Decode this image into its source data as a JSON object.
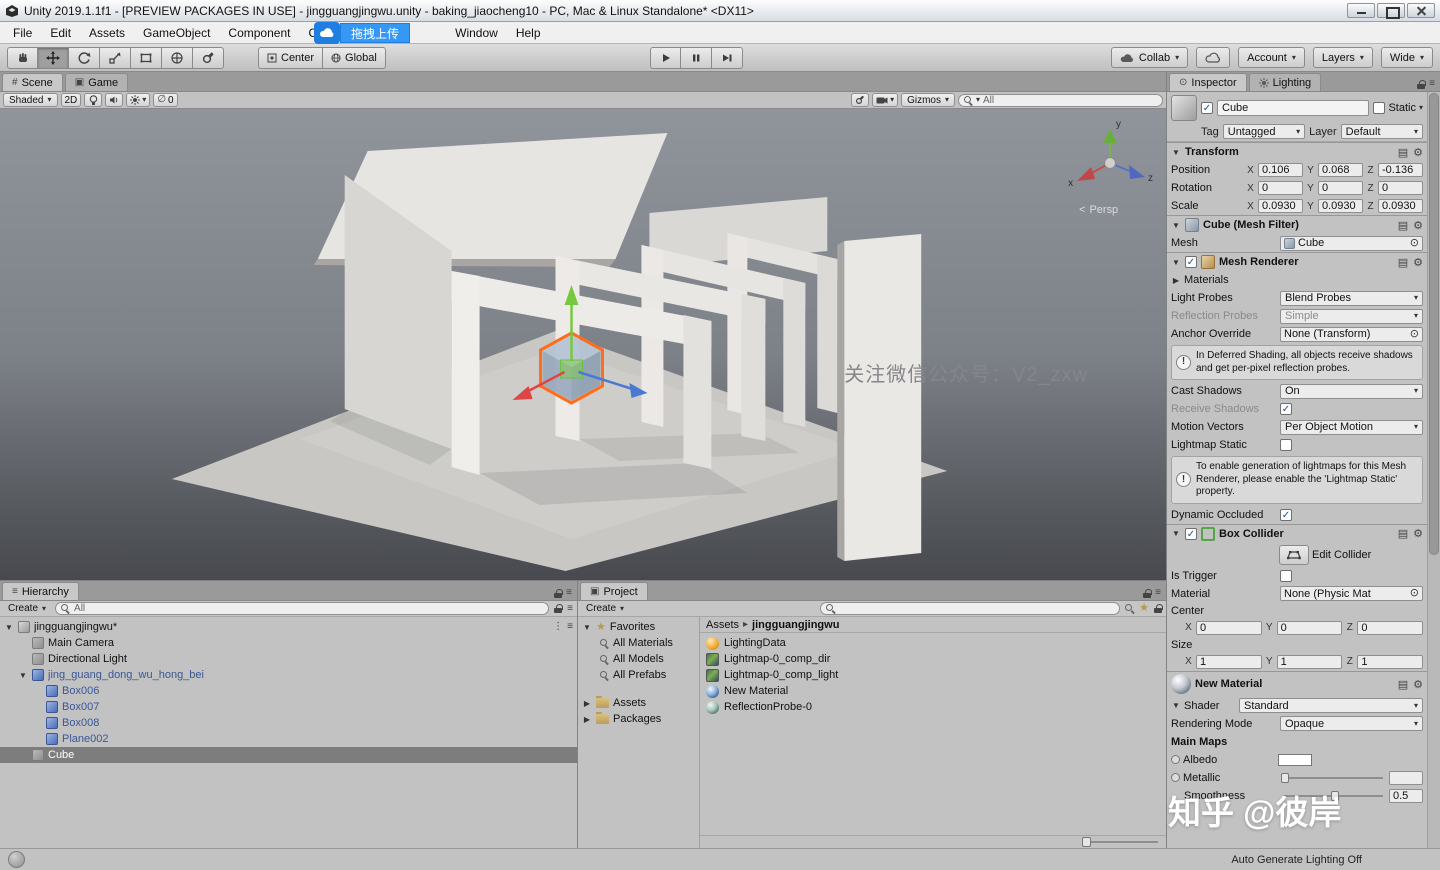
{
  "window": {
    "title": "Unity 2019.1.1f1 - [PREVIEW PACKAGES IN USE] - jingguangjingwu.unity - baking_jiaocheng10 - PC, Mac & Linux Standalone* <DX11>"
  },
  "menu": {
    "items": [
      "File",
      "Edit",
      "Assets",
      "GameObject",
      "Component",
      "Cine",
      "Window",
      "Help"
    ]
  },
  "upload_overlay": {
    "label": "拖拽上传"
  },
  "toolbar": {
    "pivot": "Center",
    "space": "Global",
    "collab": "Collab",
    "account": "Account",
    "layers": "Layers",
    "layout": "Wide"
  },
  "scene": {
    "tab_scene": "Scene",
    "tab_game": "Game",
    "shading": "Shaded",
    "mode_2d": "2D",
    "hidden_count": "0",
    "gizmos": "Gizmos",
    "search_value": "All",
    "persp": "Persp",
    "axis": {
      "x": "x",
      "y": "y",
      "z": "z"
    },
    "watermark": "关注微信公众号：V2_zxw"
  },
  "hierarchy": {
    "title": "Hierarchy",
    "create": "Create",
    "search_value": "All",
    "items": [
      {
        "label": "jingguangjingwu*"
      },
      {
        "label": "Main Camera"
      },
      {
        "label": "Directional Light"
      },
      {
        "label": "jing_guang_dong_wu_hong_bei"
      },
      {
        "label": "Box006"
      },
      {
        "label": "Box007"
      },
      {
        "label": "Box008"
      },
      {
        "label": "Plane002"
      },
      {
        "label": "Cube"
      }
    ]
  },
  "project": {
    "title": "Project",
    "create": "Create",
    "favorites_label": "Favorites",
    "favorites": [
      {
        "label": "All Materials"
      },
      {
        "label": "All Models"
      },
      {
        "label": "All Prefabs"
      }
    ],
    "folders": [
      {
        "label": "Assets"
      },
      {
        "label": "Packages"
      }
    ],
    "breadcrumb": {
      "root": "Assets",
      "current": "jingguangjingwu"
    },
    "files": [
      {
        "name": "LightingData"
      },
      {
        "name": "Lightmap-0_comp_dir"
      },
      {
        "name": "Lightmap-0_comp_light"
      },
      {
        "name": "New Material"
      },
      {
        "name": "ReflectionProbe-0"
      }
    ]
  },
  "inspector": {
    "tab_inspector": "Inspector",
    "tab_lighting": "Lighting",
    "axes": {
      "x": "X",
      "y": "Y",
      "z": "Z"
    },
    "header": {
      "name": "Cube",
      "static": "Static",
      "tag_label": "Tag",
      "tag": "Untagged",
      "layer_label": "Layer",
      "layer": "Default"
    },
    "transform": {
      "title": "Transform",
      "rows": [
        {
          "label": "Position",
          "x": "0.106",
          "y": "0.068",
          "z": "-0.136"
        },
        {
          "label": "Rotation",
          "x": "0",
          "y": "0",
          "z": "0"
        },
        {
          "label": "Scale",
          "x": "0.0930",
          "y": "0.0930",
          "z": "0.0930"
        }
      ]
    },
    "mesh_filter": {
      "title": "Cube (Mesh Filter)",
      "mesh_label": "Mesh",
      "mesh": "Cube"
    },
    "mesh_renderer": {
      "title": "Mesh Renderer",
      "materials": "Materials",
      "light_probes_label": "Light Probes",
      "light_probes": "Blend Probes",
      "reflection_probes_label": "Reflection Probes",
      "reflection_probes": "Simple",
      "anchor_label": "Anchor Override",
      "anchor": "None (Transform)",
      "deferred_info": "In Deferred Shading, all objects receive shadows and get per-pixel reflection probes.",
      "cast_shadows_label": "Cast Shadows",
      "cast_shadows": "On",
      "receive_shadows_label": "Receive Shadows",
      "motion_vectors_label": "Motion Vectors",
      "motion_vectors": "Per Object Motion",
      "lightmap_static_label": "Lightmap Static",
      "lightmap_info": "To enable generation of lightmaps for this Mesh Renderer, please enable the 'Lightmap Static' property.",
      "dynamic_occluded_label": "Dynamic Occluded"
    },
    "box_collider": {
      "title": "Box Collider",
      "edit": "Edit Collider",
      "is_trigger": "Is Trigger",
      "material_label": "Material",
      "material": "None (Physic Mat",
      "center_label": "Center",
      "center": {
        "x": "0",
        "y": "0",
        "z": "0"
      },
      "size_label": "Size",
      "size": {
        "x": "1",
        "y": "1",
        "z": "1"
      }
    },
    "material": {
      "title": "New Material",
      "shader_label": "Shader",
      "shader": "Standard",
      "rendering_label": "Rendering Mode",
      "rendering": "Opaque",
      "main_maps": "Main Maps",
      "albedo": "Albedo",
      "metallic": "Metallic",
      "smoothness_label": "Smoothness",
      "smoothness": "0.5"
    },
    "watermark": "知乎 @彼岸"
  },
  "status": {
    "auto_generate": "Auto Generate Lighting Off"
  },
  "icons": {
    "caret": "▾",
    "fold_open": "▼",
    "fold_closed": "▶",
    "menu": "≡",
    "dots": "⋮",
    "picker": "⊙",
    "check": "✓",
    "star": "★",
    "crumb": "▸",
    "persp_arrow": "<",
    "hidden": "∅",
    "warn": "!",
    "gear": "⚙",
    "doc": "▤",
    "hash": "#",
    "screen": "▣"
  }
}
